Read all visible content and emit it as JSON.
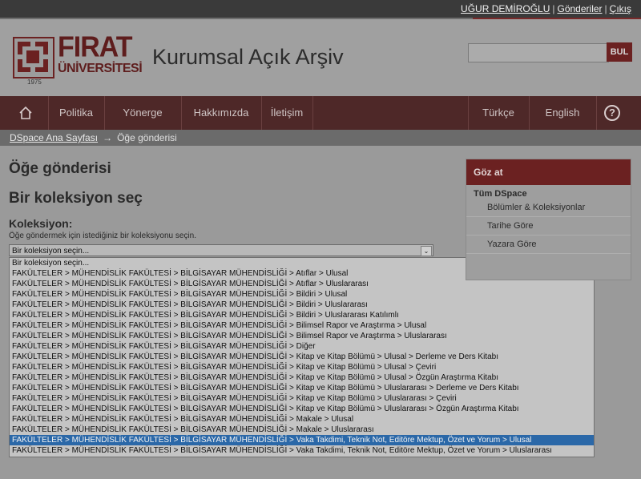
{
  "user_bar": {
    "user_name": "UĞUR DEMİROĞLU",
    "sep1": "|",
    "submissions": "Gönderiler",
    "sep2": "|",
    "logout": "Çıkış"
  },
  "header": {
    "logo_line1": "FIRAT",
    "logo_line2": "ÜNİVERSİTESİ",
    "logo_year": "1975",
    "site_title": "Kurumsal Açık Arşiv",
    "search_placeholder": "",
    "search_button": "BUL"
  },
  "nav": {
    "items": [
      "Politika",
      "Yönerge",
      "Hakkımızda",
      "İletişim"
    ],
    "lang_tr": "Türkçe",
    "lang_en": "English",
    "help_glyph": "?"
  },
  "breadcrumb": {
    "home": "DSpace Ana Sayfası",
    "arrow": "→",
    "current": "Öğe gönderisi"
  },
  "main": {
    "title": "Öğe gönderisi",
    "subtitle": "Bir koleksiyon seç",
    "field_label": "Koleksiyon:",
    "field_help": "Öğe göndermek için istediğiniz bir koleksiyonu seçin.",
    "selected_value": "Bir koleksiyon seçin...",
    "select_arrow_glyph": "⌄",
    "selected_index": 17,
    "options": [
      "Bir koleksiyon seçin...",
      "FAKÜLTELER > MÜHENDİSLİK FAKÜLTESİ > BİLGİSAYAR MÜHENDİSLİĞİ > Atıflar > Ulusal",
      "FAKÜLTELER > MÜHENDİSLİK FAKÜLTESİ > BİLGİSAYAR MÜHENDİSLİĞİ > Atıflar > Uluslararası",
      "FAKÜLTELER > MÜHENDİSLİK FAKÜLTESİ > BİLGİSAYAR MÜHENDİSLİĞİ > Bildiri > Ulusal",
      "FAKÜLTELER > MÜHENDİSLİK FAKÜLTESİ > BİLGİSAYAR MÜHENDİSLİĞİ > Bildiri > Uluslararası",
      "FAKÜLTELER > MÜHENDİSLİK FAKÜLTESİ > BİLGİSAYAR MÜHENDİSLİĞİ > Bildiri > Uluslararası Katılımlı",
      "FAKÜLTELER > MÜHENDİSLİK FAKÜLTESİ > BİLGİSAYAR MÜHENDİSLİĞİ > Bilimsel Rapor ve Araştırma > Ulusal",
      "FAKÜLTELER > MÜHENDİSLİK FAKÜLTESİ > BİLGİSAYAR MÜHENDİSLİĞİ > Bilimsel Rapor ve Araştırma > Uluslararası",
      "FAKÜLTELER > MÜHENDİSLİK FAKÜLTESİ > BİLGİSAYAR MÜHENDİSLİĞİ > Diğer",
      "FAKÜLTELER > MÜHENDİSLİK FAKÜLTESİ > BİLGİSAYAR MÜHENDİSLİĞİ > Kitap ve Kitap Bölümü > Ulusal > Derleme ve Ders Kitabı",
      "FAKÜLTELER > MÜHENDİSLİK FAKÜLTESİ > BİLGİSAYAR MÜHENDİSLİĞİ > Kitap ve Kitap Bölümü > Ulusal > Çeviri",
      "FAKÜLTELER > MÜHENDİSLİK FAKÜLTESİ > BİLGİSAYAR MÜHENDİSLİĞİ > Kitap ve Kitap Bölümü > Ulusal > Özgün Araştırma Kitabı",
      "FAKÜLTELER > MÜHENDİSLİK FAKÜLTESİ > BİLGİSAYAR MÜHENDİSLİĞİ > Kitap ve Kitap Bölümü > Uluslararası > Derleme ve Ders Kitabı",
      "FAKÜLTELER > MÜHENDİSLİK FAKÜLTESİ > BİLGİSAYAR MÜHENDİSLİĞİ > Kitap ve Kitap Bölümü > Uluslararası > Çeviri",
      "FAKÜLTELER > MÜHENDİSLİK FAKÜLTESİ > BİLGİSAYAR MÜHENDİSLİĞİ > Kitap ve Kitap Bölümü > Uluslararası > Özgün Araştırma Kitabı",
      "FAKÜLTELER > MÜHENDİSLİK FAKÜLTESİ > BİLGİSAYAR MÜHENDİSLİĞİ > Makale > Ulusal",
      "FAKÜLTELER > MÜHENDİSLİK FAKÜLTESİ > BİLGİSAYAR MÜHENDİSLİĞİ > Makale > Uluslararası",
      "FAKÜLTELER > MÜHENDİSLİK FAKÜLTESİ > BİLGİSAYAR MÜHENDİSLİĞİ > Vaka Takdimi, Teknik Not, Editöre Mektup, Özet ve Yorum > Ulusal",
      "FAKÜLTELER > MÜHENDİSLİK FAKÜLTESİ > BİLGİSAYAR MÜHENDİSLİĞİ > Vaka Takdimi, Teknik Not, Editöre Mektup, Özet ve Yorum > Uluslararası"
    ]
  },
  "sidebar": {
    "title": "Göz at",
    "group": "Tüm DSpace",
    "links": [
      "Bölümler & Koleksiyonlar",
      "Tarihe Göre",
      "Yazara Göre"
    ]
  }
}
